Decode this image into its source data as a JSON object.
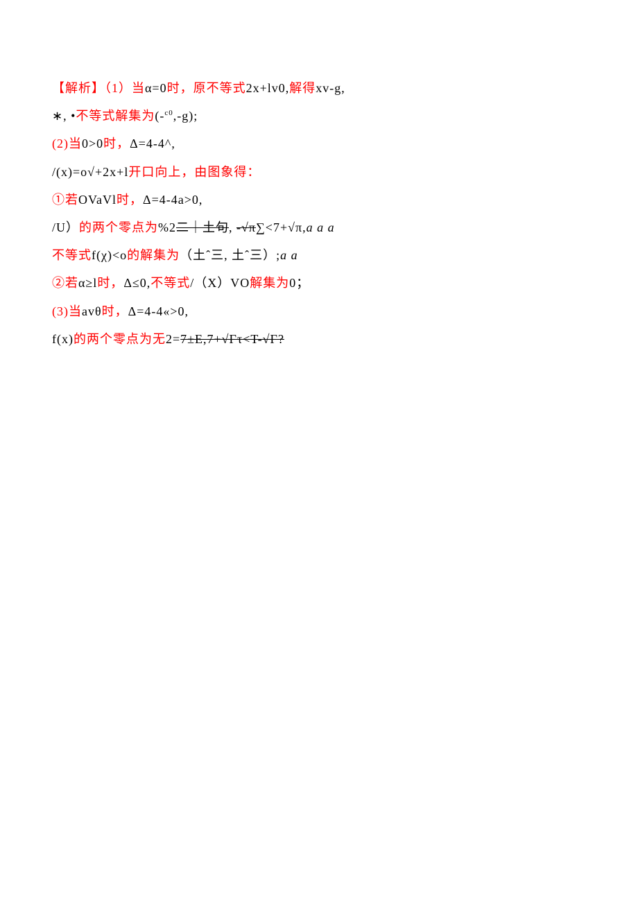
{
  "lines": [
    {
      "segments": [
        {
          "text": "【解析】（1）",
          "cls": "red"
        },
        {
          "text": "当",
          "cls": "red"
        },
        {
          "text": "α=0",
          "cls": "black"
        },
        {
          "text": "时，原不等式",
          "cls": "red"
        },
        {
          "text": "2x+lv0,",
          "cls": "black"
        },
        {
          "text": "解得",
          "cls": "red"
        },
        {
          "text": "xv-g,",
          "cls": "black"
        }
      ]
    },
    {
      "segments": [
        {
          "text": "∗, •",
          "cls": "black"
        },
        {
          "text": "不等式解集为",
          "cls": "red"
        },
        {
          "text": "(-",
          "cls": "black"
        },
        {
          "text": "c0",
          "cls": "black sup"
        },
        {
          "text": ",-g);",
          "cls": "black"
        }
      ]
    },
    {
      "segments": [
        {
          "text": "(2)",
          "cls": "red"
        },
        {
          "text": "当",
          "cls": "red"
        },
        {
          "text": "0>0",
          "cls": "black"
        },
        {
          "text": "时，",
          "cls": "red"
        },
        {
          "text": "Δ=4-4^,",
          "cls": "black"
        }
      ]
    },
    {
      "segments": [
        {
          "text": "/(x)=o√+2x+l",
          "cls": "black"
        },
        {
          "text": "开口向上，由图象得：",
          "cls": "red"
        }
      ]
    },
    {
      "segments": [
        {
          "text": "①若",
          "cls": "red"
        },
        {
          "text": "OVaVl",
          "cls": "black"
        },
        {
          "text": "时，",
          "cls": "red"
        },
        {
          "text": "Δ=4-4a>0,",
          "cls": "black"
        }
      ]
    },
    {
      "segments": [
        {
          "text": "/U）",
          "cls": "black"
        },
        {
          "text": "的两个零点为",
          "cls": "red"
        },
        {
          "text": "%2",
          "cls": "black"
        },
        {
          "text": "二｜土句",
          "cls": "black strike"
        },
        {
          "text": ",  ",
          "cls": "black"
        },
        {
          "text": "-√π",
          "cls": "black strike"
        },
        {
          "text": "∑<7+√π,",
          "cls": "black"
        },
        {
          "text": "a      a a",
          "cls": "black italic"
        }
      ]
    },
    {
      "segments": [
        {
          "text": "不等式",
          "cls": "red"
        },
        {
          "text": "f(χ)<o",
          "cls": "black"
        },
        {
          "text": "的解集为",
          "cls": "red"
        },
        {
          "text": "（土ˆ三, 土ˆ三）;",
          "cls": "black"
        },
        {
          "text": "a      a",
          "cls": "black italic"
        }
      ]
    },
    {
      "segments": [
        {
          "text": "②若",
          "cls": "red"
        },
        {
          "text": "α≥l",
          "cls": "black"
        },
        {
          "text": "时，",
          "cls": "red"
        },
        {
          "text": "Δ≤0,",
          "cls": "black"
        },
        {
          "text": "不等式",
          "cls": "red"
        },
        {
          "text": "/（X）VO",
          "cls": "black"
        },
        {
          "text": "解集为",
          "cls": "red"
        },
        {
          "text": "0；",
          "cls": "black"
        }
      ]
    },
    {
      "segments": [
        {
          "text": "(3)",
          "cls": "red"
        },
        {
          "text": "当",
          "cls": "red"
        },
        {
          "text": "avθ",
          "cls": "black"
        },
        {
          "text": "时，",
          "cls": "red"
        },
        {
          "text": "Δ=4-4«>0,",
          "cls": "black"
        }
      ]
    },
    {
      "segments": [
        {
          "text": "f(x)",
          "cls": "black"
        },
        {
          "text": "的两个零点为无",
          "cls": "red"
        },
        {
          "text": "2=",
          "cls": "black"
        },
        {
          "text": "7±E,7+√Гτ<T-√Г?",
          "cls": "black strike"
        }
      ]
    }
  ]
}
